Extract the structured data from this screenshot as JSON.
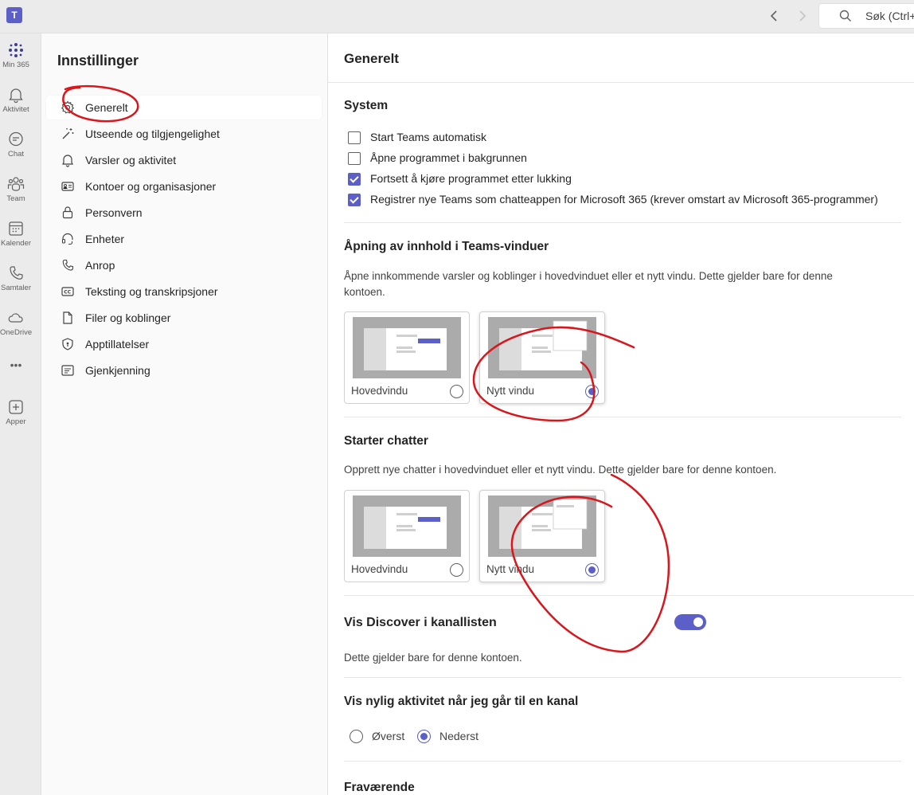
{
  "topbar": {
    "app_logo": "T",
    "back_icon": "chevron-left-icon",
    "forward_icon": "chevron-right-icon",
    "search_placeholder": "Søk (Ctrl+"
  },
  "rail": {
    "items": [
      {
        "label": "Min 365",
        "icon": "grid-dots-icon"
      },
      {
        "label": "Aktivitet",
        "icon": "bell-icon"
      },
      {
        "label": "Chat",
        "icon": "chat-icon"
      },
      {
        "label": "Team",
        "icon": "team-icon"
      },
      {
        "label": "Kalender",
        "icon": "calendar-icon"
      },
      {
        "label": "Samtaler",
        "icon": "phone-icon"
      },
      {
        "label": "OneDrive",
        "icon": "cloud-icon"
      },
      {
        "label": "•••",
        "icon": "more-icon"
      },
      {
        "label": "Apper",
        "icon": "add-apps-icon"
      }
    ]
  },
  "sidebar": {
    "title": "Innstillinger",
    "items": [
      {
        "label": "Generelt",
        "icon": "gear-icon"
      },
      {
        "label": "Utseende og tilgjengelighet",
        "icon": "magic-wand-icon"
      },
      {
        "label": "Varsler og aktivitet",
        "icon": "bell-icon"
      },
      {
        "label": "Kontoer og organisasjoner",
        "icon": "contact-card-icon"
      },
      {
        "label": "Personvern",
        "icon": "lock-icon"
      },
      {
        "label": "Enheter",
        "icon": "headset-icon"
      },
      {
        "label": "Anrop",
        "icon": "phone-icon"
      },
      {
        "label": "Teksting og transkripsjoner",
        "icon": "closed-caption-icon"
      },
      {
        "label": "Filer og koblinger",
        "icon": "document-icon"
      },
      {
        "label": "Apptillatelser",
        "icon": "shield-icon"
      },
      {
        "label": "Gjenkjenning",
        "icon": "recognition-icon"
      }
    ]
  },
  "main": {
    "title": "Generelt",
    "system": {
      "title": "System",
      "options": [
        {
          "label": "Start Teams automatisk",
          "checked": false
        },
        {
          "label": "Åpne programmet i bakgrunnen",
          "checked": false
        },
        {
          "label": "Fortsett å kjøre programmet etter lukking",
          "checked": true
        },
        {
          "label": "Registrer nye Teams som chatteappen for Microsoft 365 (krever omstart av Microsoft 365-programmer)",
          "checked": true
        }
      ]
    },
    "opening": {
      "title": "Åpning av innhold i Teams-vinduer",
      "desc_line1": "Åpne innkommende varsler og koblinger i hovedvinduet eller et nytt vindu. Dette gjelder bare for denne",
      "desc_line2": "kontoen.",
      "card1_label": "Hovedvindu",
      "card2_label": "Nytt vindu",
      "selected": "Nytt vindu"
    },
    "chats": {
      "title": "Starter chatter",
      "desc": "Opprett nye chatter i hovedvinduet eller et nytt vindu. Dette gjelder bare for denne kontoen.",
      "card1_label": "Hovedvindu",
      "card2_label": "Nytt vindu",
      "selected": "Nytt vindu"
    },
    "discover": {
      "title": "Vis Discover i kanallisten",
      "desc": "Dette gjelder bare for denne kontoen.",
      "enabled": true
    },
    "recent": {
      "title": "Vis nylig aktivitet når jeg går til en kanal",
      "option_top": "Øverst",
      "option_bottom": "Nederst",
      "selected": "Nederst"
    },
    "absence": {
      "title": "Fraværende"
    }
  },
  "colors": {
    "accent": "#5b5fc7",
    "annotation": "#d9161c"
  }
}
